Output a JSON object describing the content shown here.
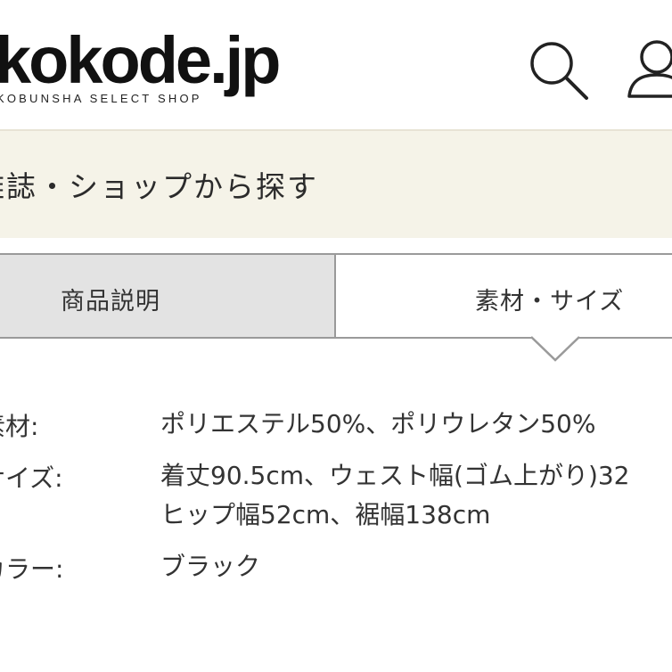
{
  "header": {
    "logo_main": "kokode.jp",
    "logo_tagline": "KOBUNSHA SELECT SHOP",
    "search_icon": "search-icon",
    "account_icon": "user-icon"
  },
  "banner": {
    "text": "雑誌・ショップから探す",
    "background": "#f5f3e8"
  },
  "tabs": [
    {
      "label": "商品説明",
      "active": false
    },
    {
      "label": "素材・サイズ",
      "active": true
    }
  ],
  "specs": [
    {
      "label": "素材:",
      "lines": [
        "ポリエステル50%、ポリウレタン50%"
      ]
    },
    {
      "label": "サイズ:",
      "lines": [
        "着丈90.5cm、ウェスト幅(ゴム上がり)32",
        "ヒップ幅52cm、裾幅138cm"
      ]
    },
    {
      "label": "カラー:",
      "lines": [
        "ブラック"
      ]
    }
  ]
}
